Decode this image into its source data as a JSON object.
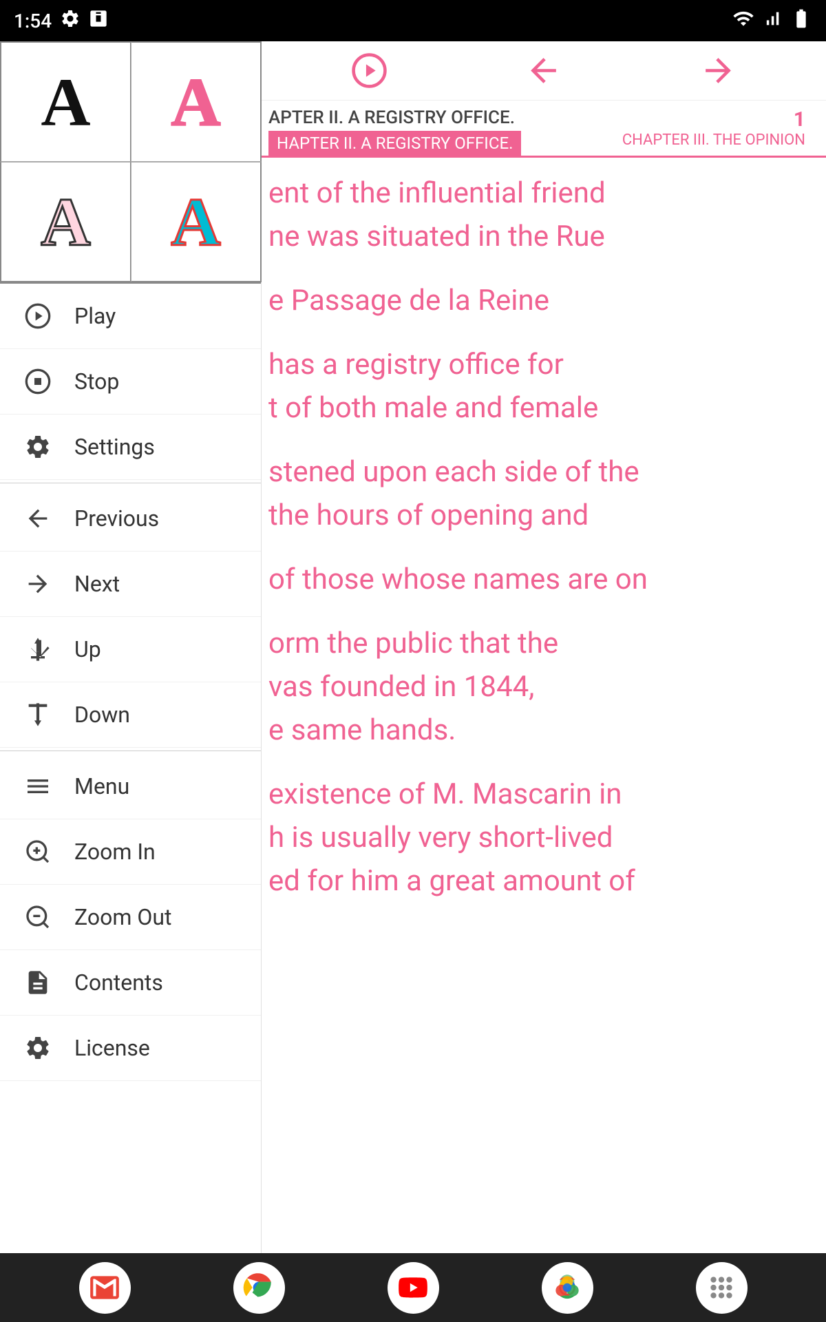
{
  "status": {
    "time": "1:54",
    "icons": [
      "settings",
      "sim-card"
    ]
  },
  "font_selector": {
    "cells": [
      {
        "label": "A",
        "style": "black-serif"
      },
      {
        "label": "A",
        "style": "pink-serif"
      },
      {
        "label": "A",
        "style": "outline-pink-serif"
      },
      {
        "label": "A",
        "style": "cyan-red-serif"
      }
    ]
  },
  "menu": {
    "items": [
      {
        "id": "play",
        "label": "Play",
        "icon": "play-icon"
      },
      {
        "id": "stop",
        "label": "Stop",
        "icon": "stop-icon"
      },
      {
        "id": "settings",
        "label": "Settings",
        "icon": "settings-icon"
      },
      {
        "id": "previous",
        "label": "Previous",
        "icon": "previous-icon"
      },
      {
        "id": "next",
        "label": "Next",
        "icon": "next-icon"
      },
      {
        "id": "up",
        "label": "Up",
        "icon": "up-icon"
      },
      {
        "id": "down",
        "label": "Down",
        "icon": "down-icon"
      },
      {
        "id": "menu",
        "label": "Menu",
        "icon": "menu-icon"
      },
      {
        "id": "zoom-in",
        "label": "Zoom In",
        "icon": "zoom-in-icon"
      },
      {
        "id": "zoom-out",
        "label": "Zoom Out",
        "icon": "zoom-out-icon"
      },
      {
        "id": "contents",
        "label": "Contents",
        "icon": "contents-icon"
      },
      {
        "id": "license",
        "label": "License",
        "icon": "license-icon"
      }
    ]
  },
  "top_nav": {
    "play_label": "play",
    "back_label": "back",
    "forward_label": "forward"
  },
  "chapter_nav": {
    "current_chapter": "APTER II. A REGISTRY OFFICE.",
    "tab_label": "HAPTER II. A REGISTRY OFFICE.",
    "page_number": "1",
    "next_chapter": "CHAPTER III. THE OPINION"
  },
  "book_text": {
    "paragraphs": [
      "ent of the influential friend\nne was situated in the Rue",
      "e Passage de la Reine",
      "has a registry office for\nt of both male and female",
      "stened upon each side of the\nthe hours of opening and",
      "of those whose names are on",
      "orm the public that the\nvas founded in 1844,\ne same hands.",
      "existence of M. Mascarin in\nh is usually very short-lived\ned for him a great amount of"
    ]
  },
  "bottom_apps": {
    "apps": [
      {
        "name": "Gmail",
        "icon": "gmail-icon"
      },
      {
        "name": "Chrome",
        "icon": "chrome-icon"
      },
      {
        "name": "YouTube",
        "icon": "youtube-icon"
      },
      {
        "name": "Photos",
        "icon": "photos-icon"
      },
      {
        "name": "Apps",
        "icon": "apps-icon"
      }
    ]
  }
}
